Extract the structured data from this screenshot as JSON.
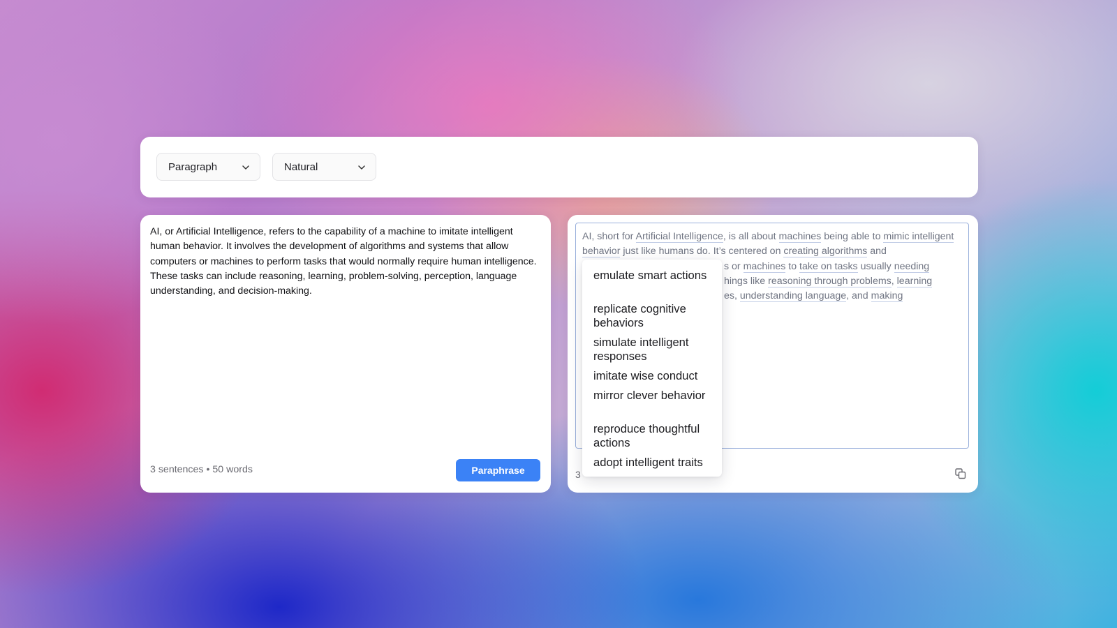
{
  "toolbar": {
    "mode_select": {
      "value": "Paragraph"
    },
    "tone_select": {
      "value": "Natural"
    }
  },
  "input": {
    "text": "AI, or Artificial Intelligence, refers to the capability of a machine to imitate intelligent human behavior. It involves the development of algorithms and systems that allow computers or machines to perform tasks that would normally require human intelligence. These tasks can include reasoning, learning, problem-solving, perception, language understanding, and decision-making.",
    "counts": "3 sentences • 50 words",
    "button_label": "Paraphrase"
  },
  "output": {
    "segments": [
      "AI, short for ",
      "Artificial Intelligence",
      ", is all about ",
      "machines",
      " being able to ",
      "mimic intelligent behavior",
      " just like humans do. It’s centered on ",
      "creating algorithms",
      " and ",
      "s or ",
      "machines",
      " to ",
      "take on tasks",
      " usually ",
      "needing",
      "hings like ",
      "reasoning through problems",
      ", ",
      "learning",
      "es, ",
      "understanding language",
      ", and ",
      "making"
    ],
    "count_partial": "3",
    "icon": "copy-icon"
  },
  "suggestions": [
    "emulate smart actions",
    "replicate cognitive behaviors",
    "simulate intelligent responses",
    "imitate wise conduct",
    "mirror clever behavior",
    "reproduce thoughtful actions",
    "adopt intelligent traits"
  ]
}
